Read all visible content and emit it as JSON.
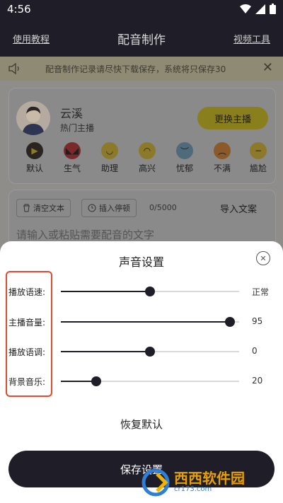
{
  "status_bar": {
    "time": "4:56"
  },
  "header": {
    "left_link": "使用教程",
    "title": "配音制作",
    "right_link": "视频工具"
  },
  "notice": {
    "text": "配音制作记录请尽快下载保存，系统将只保存30"
  },
  "anchor": {
    "name": "云溪",
    "tag": "热门主播",
    "change_button": "更换主播",
    "emotions": [
      {
        "label": "默认",
        "icon": "play-icon"
      },
      {
        "label": "生气",
        "icon": "angry-face-icon"
      },
      {
        "label": "助理",
        "icon": "smile-face-icon"
      },
      {
        "label": "高兴",
        "icon": "happy-face-icon"
      },
      {
        "label": "忧郁",
        "icon": "sad-face-icon"
      },
      {
        "label": "不满",
        "icon": "displeased-face-icon"
      },
      {
        "label": "尴尬",
        "icon": "awkward-face-icon"
      }
    ]
  },
  "editor": {
    "clear_button": "清空文本",
    "pause_button": "插入停顿",
    "counter": "0/5000",
    "import_button": "导入文案",
    "placeholder": "请输入或粘贴需要配音的文字"
  },
  "sheet": {
    "title": "声音设置",
    "rows": [
      {
        "label": "播放语速:",
        "value_text": "正常",
        "level": 0.5
      },
      {
        "label": "主播音量:",
        "value_text": "95",
        "level": 0.95
      },
      {
        "label": "播放语调:",
        "value_text": "0",
        "level": 0.5
      },
      {
        "label": "背景音乐:",
        "value_text": "20",
        "level": 0.2
      }
    ],
    "reset_button": "恢复默认",
    "save_button": "保存设置"
  },
  "watermark": {
    "text": "西西软件园",
    "url": "cr173.com"
  },
  "colors": {
    "accent": "#1f1d28",
    "highlight": "#e04a2e",
    "yellow_button": "#f2d51c"
  }
}
